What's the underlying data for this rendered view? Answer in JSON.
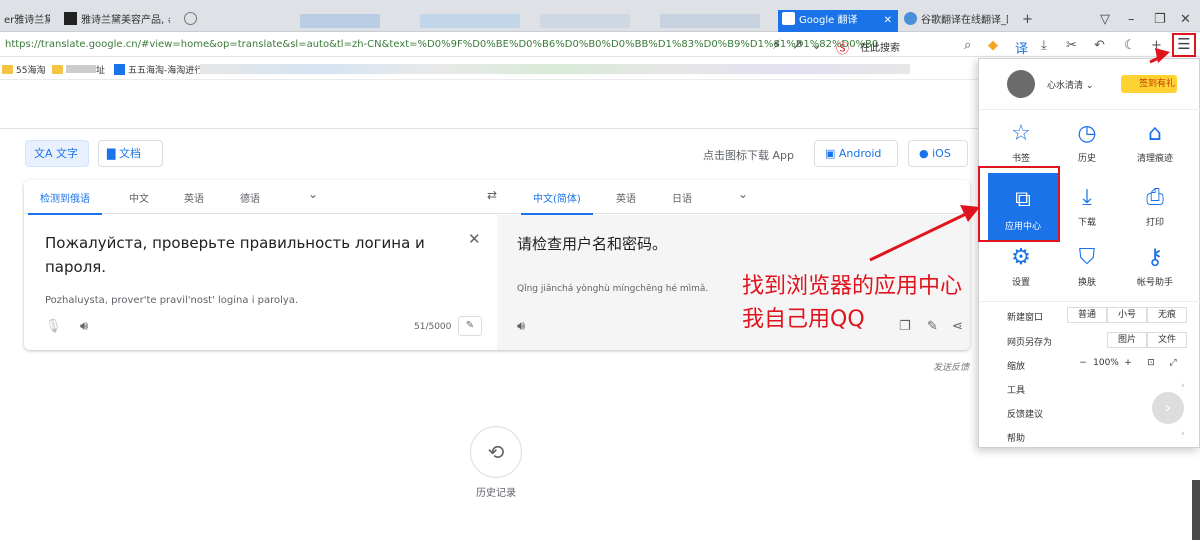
{
  "tabs": [
    {
      "label": "er雅诗兰黛"
    },
    {
      "label": "雅诗兰黛美容产品, #"
    },
    {
      "label": "Google 翻译",
      "active": true
    },
    {
      "label": "谷歌翻译在线翻译_四"
    }
  ],
  "address": {
    "url": "https://translate.google.cn/#view=home&op=translate&sl=auto&tl=zh-CN&text=%D0%9F%D0%BE%D0%B6%D0%B0%D0%BB%D1%83%D0%B9%D1%81%D1%82%D0%B0",
    "search_label": "在此搜索"
  },
  "bookmarks": [
    {
      "label": "55海淘"
    },
    {
      "label": "址"
    },
    {
      "label": "五五海淘-海淘进行"
    }
  ],
  "modes": {
    "text": "文字",
    "doc": "文档"
  },
  "download": {
    "label": "点击图标下载 App",
    "android": "Android",
    "ios": "iOS"
  },
  "source_langs": [
    "检测到俄语",
    "中文",
    "英语",
    "德语"
  ],
  "target_langs": [
    "中文(简体)",
    "英语",
    "日语"
  ],
  "source_text": "Пожалуйста, проверьте правильность логина и пароля.",
  "source_romanization": "Pozhaluysta, prover'te pravil'nost' logina i parolya.",
  "char_count": "51/5000",
  "target_text": "请检查用户名和密码。",
  "target_romanization": "Qǐng jiǎnchá yònghù míngchēng hé mìmǎ.",
  "feedback": "发送反馈",
  "history_label": "历史记录",
  "menu": {
    "user": "心水清清",
    "checkin": "签到有礼",
    "grid": [
      {
        "label": "书签",
        "icon": "star-icon"
      },
      {
        "label": "历史",
        "icon": "clock-icon"
      },
      {
        "label": "清理痕迹",
        "icon": "broom-icon"
      },
      {
        "label": "应用中心",
        "icon": "puzzle-icon"
      },
      {
        "label": "下载",
        "icon": "download-icon"
      },
      {
        "label": "打印",
        "icon": "printer-icon"
      },
      {
        "label": "设置",
        "icon": "gear-icon"
      },
      {
        "label": "换肤",
        "icon": "shirt-icon"
      },
      {
        "label": "帐号助手",
        "icon": "key-icon"
      }
    ],
    "new_window": "新建窗口",
    "new_window_opts": [
      "普通",
      "小号",
      "无痕"
    ],
    "save_as": "网页另存为",
    "save_opts": [
      "图片",
      "文件"
    ],
    "zoom": "缩放",
    "zoom_value": "100%",
    "tools": "工具",
    "feedback": "反馈建议",
    "help": "帮助"
  },
  "annotation": [
    "找到浏览器的应用中心",
    "我自己用QQ"
  ],
  "colors": {
    "accent": "#1a73e8",
    "annotation": "#e0141e"
  }
}
